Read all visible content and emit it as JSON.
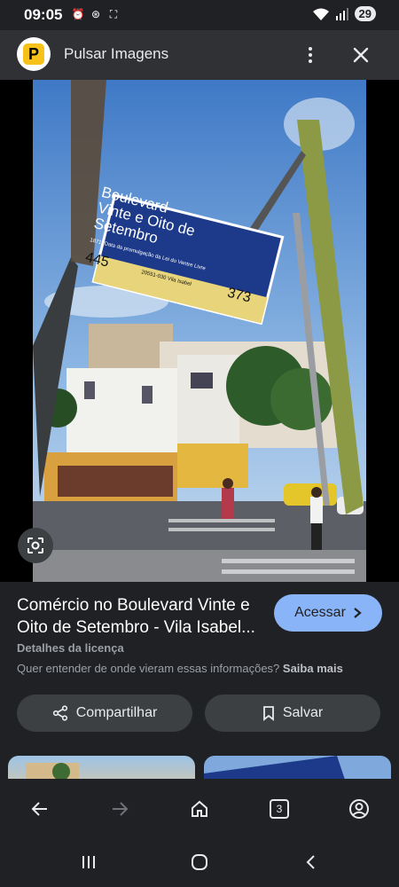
{
  "status_bar": {
    "time": "09:05",
    "battery": "29"
  },
  "header": {
    "title": "Pulsar Imagens",
    "logo_letter": "P"
  },
  "photo": {
    "sign_line1": "Boulevard",
    "sign_line2": "Vinte e Oito de",
    "sign_line3": "Setembro",
    "sign_left_number": "445",
    "sign_right_number": "373",
    "sign_small": "1871. Data da promulgação da Lei do Ventre Livre",
    "sign_cep": "20551-030  Vila Isabel"
  },
  "info": {
    "title": "Comércio no Boulevard Vinte e Oito de Setembro - Vila Isabel...",
    "acessar_label": "Acessar",
    "license_label": "Detalhes da licença",
    "understand_text": "Quer entender de onde vieram essas informações?",
    "saiba_mais": "Saiba mais",
    "share_label": "Compartilhar",
    "save_label": "Salvar"
  },
  "nav": {
    "tab_count": "3"
  },
  "colors": {
    "accent": "#8ab4f8",
    "background": "#202124",
    "surface": "#3c4043",
    "brand_yellow": "#f6c21a"
  }
}
